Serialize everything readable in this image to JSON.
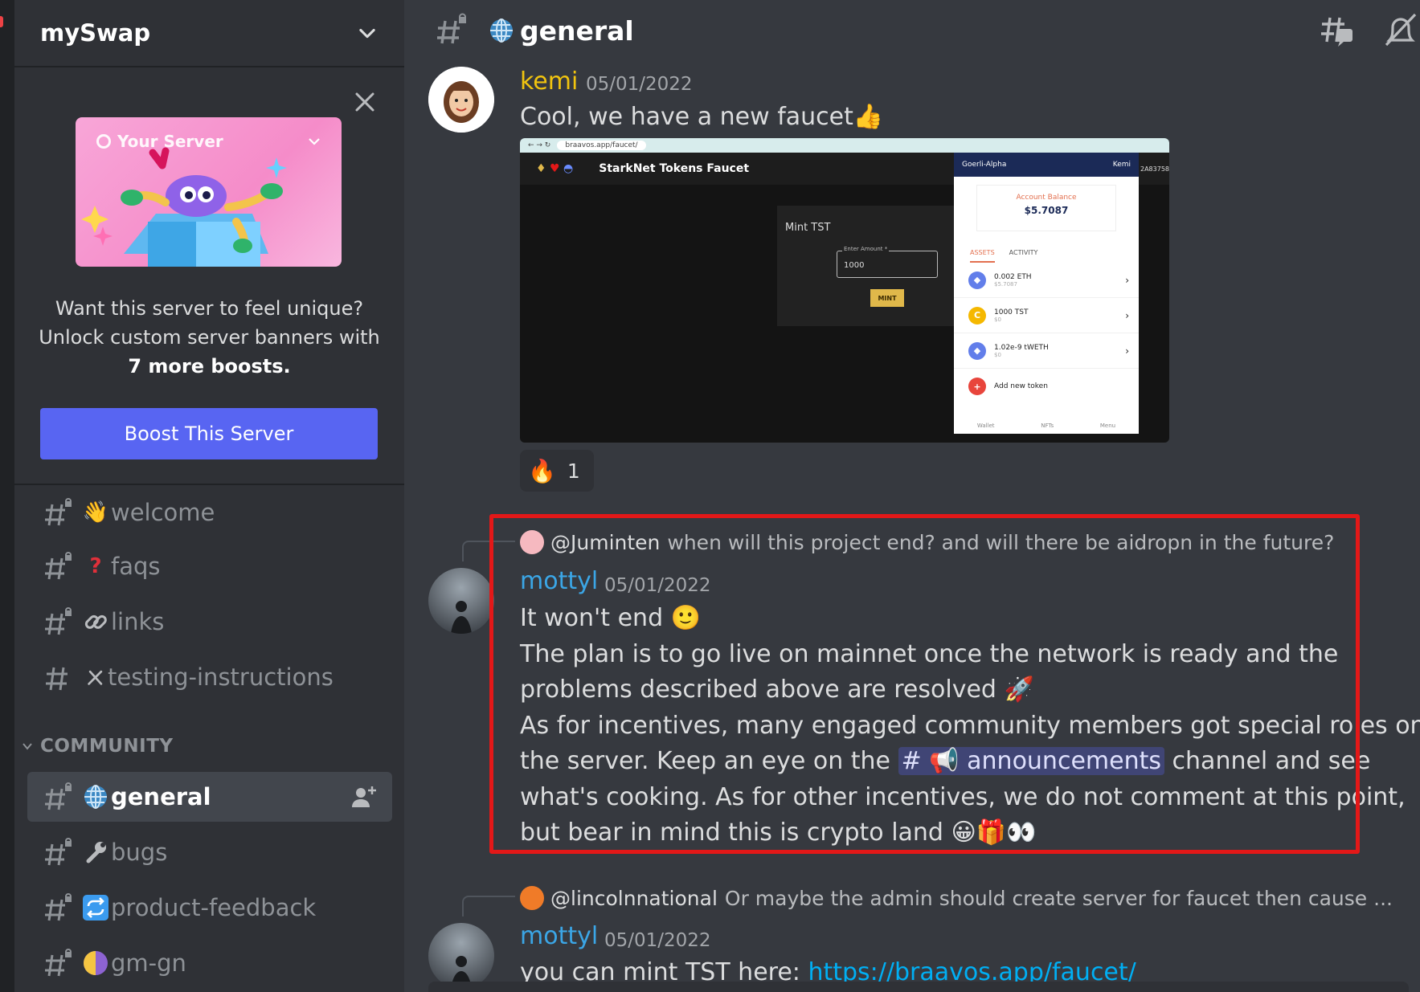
{
  "server": {
    "name": "mySwap"
  },
  "boost": {
    "banner_title": "Your Server",
    "line1": "Want this server to feel unique?",
    "line2": "Unlock custom server banners with",
    "line3": "7 more boosts.",
    "button": "Boost This Server"
  },
  "channels": [
    {
      "label": "welcome",
      "icon": "waving-hand"
    },
    {
      "label": "faqs",
      "icon": "question-mark"
    },
    {
      "label": "links",
      "icon": "link"
    },
    {
      "label": "testing-instructions",
      "icon": "tools"
    }
  ],
  "category": "COMMUNITY",
  "community_channels": [
    {
      "label": "general",
      "icon": "globe",
      "active": true
    },
    {
      "label": "bugs",
      "icon": "wrench"
    },
    {
      "label": "product-feedback",
      "icon": "repeat"
    },
    {
      "label": "gm-gn",
      "icon": "half-moon"
    }
  ],
  "header": {
    "channel": "general"
  },
  "messages": [
    {
      "author": "kemi",
      "author_color": "#f1c40f",
      "time": "05/01/2022",
      "text": "Cool, we have a new faucet",
      "reaction_count": "1",
      "attachment": {
        "url": "braavos.app/faucet/",
        "site_title": "StarkNet Tokens Faucet",
        "mint_title": "Mint TST",
        "input_label": "Enter Amount *",
        "input_value": "1000",
        "mint_button": "MINT",
        "wallet_network": "Goerli-Alpha",
        "wallet_user": "Kemi",
        "balance_label": "Account Balance",
        "balance_value": "$5.7087",
        "tab_assets": "ASSETS",
        "tab_activity": "ACTIVITY",
        "assets": [
          {
            "name": "0.002 ETH",
            "sub": "$5.7087"
          },
          {
            "name": "1000 TST",
            "sub": "$0"
          },
          {
            "name": "1.02e-9 tWETH",
            "sub": "$0"
          }
        ],
        "add_token": "Add new token",
        "footer": [
          "Wallet",
          "NFTs",
          "Menu"
        ],
        "side_text": "2A83758"
      }
    },
    {
      "reply_to": "@Juminten",
      "reply_text": "when will this project end? and will there be aidropn in the future?",
      "author": "mottyl",
      "author_color": "#3ba6e6",
      "time": "05/01/2022",
      "lines": [
        "It won't end",
        "The plan is to go live on mainnet once the network is ready and the",
        "problems described above are resolved",
        "As for incentives, many engaged community members got special roles on",
        "the server. Keep an eye on the",
        "announcements",
        "channel and see",
        "what's cooking. As for other incentives, we do not comment at this point,",
        "but bear in mind this is crypto land"
      ]
    },
    {
      "reply_to": "@lincolnnational",
      "reply_text": "Or maybe the admin should create server for faucet then cause ...",
      "author": "mottyl",
      "author_color": "#3ba6e6",
      "time": "05/01/2022",
      "text": "you can mint TST here:",
      "link": "https://braavos.app/faucet/"
    }
  ]
}
